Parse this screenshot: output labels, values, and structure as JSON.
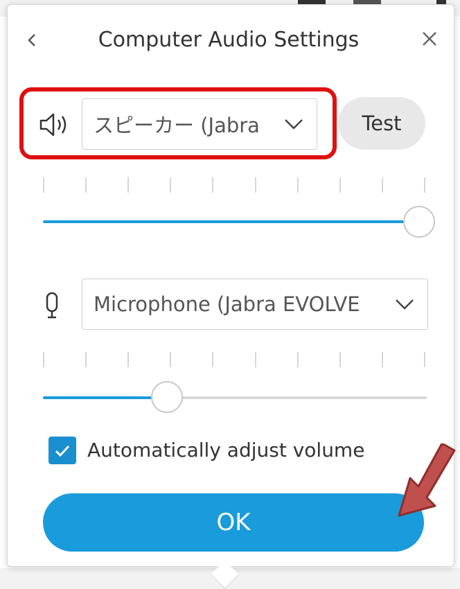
{
  "dialog": {
    "title": "Computer Audio Settings",
    "back_icon": "chevron-left-icon",
    "close_icon": "close-icon"
  },
  "speaker": {
    "icon": "speaker-icon",
    "selected_device": "スピーカー (Jabra E",
    "test_label": "Test",
    "volume_level": 1.0
  },
  "microphone": {
    "icon": "microphone-icon",
    "selected_device": "Microphone (Jabra EVOLVE",
    "volume_level": 0.3
  },
  "auto_adjust": {
    "label": "Automatically adjust volume",
    "checked": true
  },
  "ok_label": "OK",
  "colors": {
    "accent": "#1a9bdb",
    "highlight_box": "#e01010",
    "arrow": "#c0504d"
  }
}
